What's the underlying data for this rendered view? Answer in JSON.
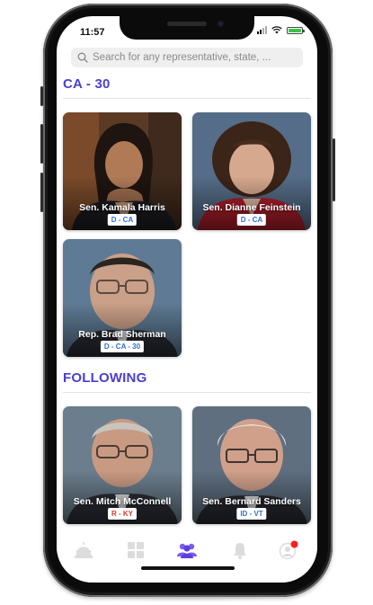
{
  "status_bar": {
    "time": "11:57"
  },
  "search": {
    "placeholder": "Search for any representative, state, ..."
  },
  "sections": [
    {
      "title": "CA - 30",
      "cards": [
        {
          "name": "Sen. Kamala Harris",
          "badge": "D - CA",
          "party_color": "#2f6fd6"
        },
        {
          "name": "Sen. Dianne Feinstein",
          "badge": "D - CA",
          "party_color": "#2f6fd6"
        },
        {
          "name": "Rep. Brad Sherman",
          "badge": "D - CA - 30",
          "party_color": "#2f6fd6"
        }
      ]
    },
    {
      "title": "FOLLOWING",
      "cards": [
        {
          "name": "Sen. Mitch McConnell",
          "badge": "R - KY",
          "party_color": "#d93a2b"
        },
        {
          "name": "Sen. Bernard Sanders",
          "badge": "ID - VT",
          "party_color": "#2f6fd6"
        }
      ]
    }
  ],
  "tab_bar": {
    "items": [
      {
        "icon": "capitol-icon",
        "active": false
      },
      {
        "icon": "grid-icon",
        "active": false
      },
      {
        "icon": "people-icon",
        "active": true
      },
      {
        "icon": "bell-icon",
        "active": false
      },
      {
        "icon": "profile-icon",
        "active": false,
        "notification_dot": true
      }
    ],
    "active_color": "#5b3fe0",
    "inactive_color": "#dcdcdc",
    "notification_color": "#ff1f1f"
  },
  "colors": {
    "accent": "#4a3fd0"
  }
}
